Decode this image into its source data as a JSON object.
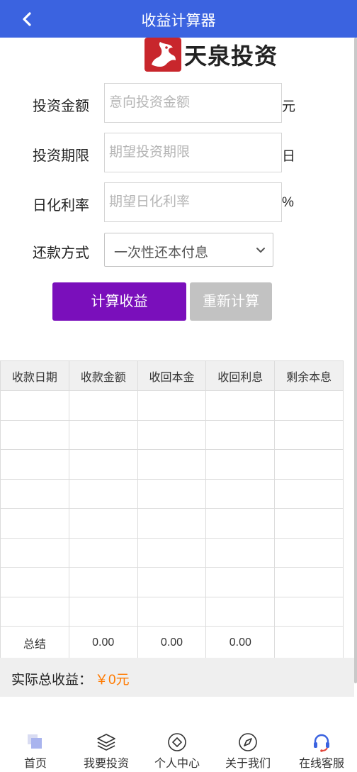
{
  "header": {
    "title": "收益计算器",
    "back_icon": "chevron-left-icon"
  },
  "logo": {
    "text": "天泉投资",
    "mark": "dragon-logo"
  },
  "form": {
    "amount": {
      "label": "投资金额",
      "placeholder": "意向投资金额",
      "value": "",
      "unit": "元"
    },
    "term": {
      "label": "投资期限",
      "placeholder": "期望投资期限",
      "value": "",
      "unit": "日"
    },
    "rate": {
      "label": "日化利率",
      "placeholder": "期望日化利率",
      "value": "",
      "unit": "%"
    },
    "repayment": {
      "label": "还款方式",
      "selected": "一次性还本付息"
    }
  },
  "buttons": {
    "calculate": "计算收益",
    "reset": "重新计算"
  },
  "table": {
    "headers": [
      "收款日期",
      "收款金额",
      "收回本金",
      "收回利息",
      "剩余本息"
    ],
    "summary": {
      "label": "总结",
      "amount": "0.00",
      "principal": "0.00",
      "interest": "0.00",
      "remaining": ""
    }
  },
  "total": {
    "label": "实际总收益：",
    "value": "￥0元"
  },
  "tabbar": [
    {
      "label": "首页",
      "icon": "home-icon"
    },
    {
      "label": "我要投资",
      "icon": "layers-icon"
    },
    {
      "label": "个人中心",
      "icon": "user-center-icon"
    },
    {
      "label": "关于我们",
      "icon": "compass-icon"
    },
    {
      "label": "在线客服",
      "icon": "headset-icon"
    }
  ],
  "colors": {
    "header": "#3b63e0",
    "calculate": "#7a0fbb",
    "reset": "#c2c2c2",
    "accent": "#ff7a00"
  }
}
